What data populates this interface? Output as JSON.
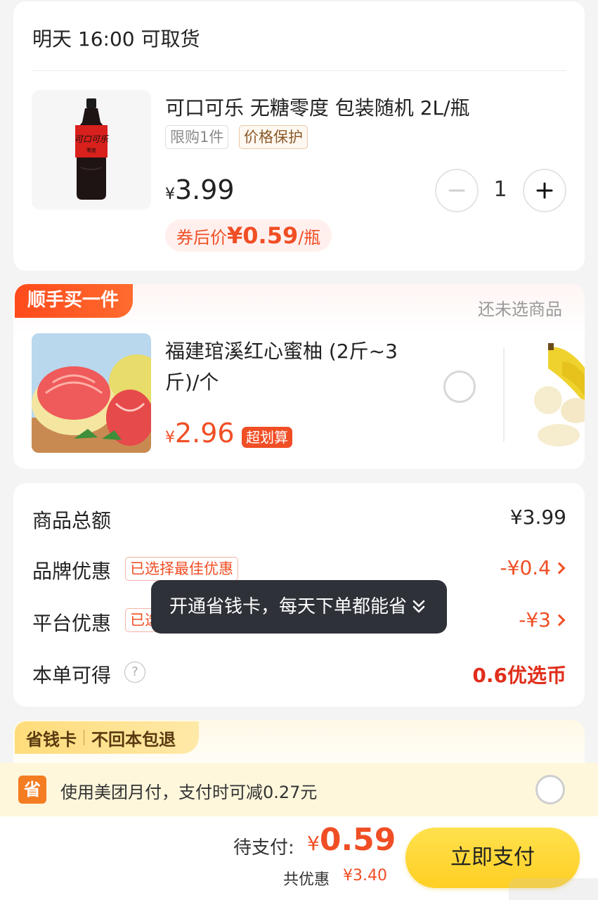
{
  "order": {
    "pickup_text": "明天 16:00 可取货",
    "product": {
      "title": "可口可乐 无糖零度 包装随机 2L/瓶",
      "tag_limit": "限购1件",
      "tag_protect": "价格保护",
      "price_symbol": "¥",
      "price": "3.99",
      "quantity": "1",
      "coupon_prefix": "券后价",
      "coupon_symbol": "¥",
      "coupon_price": "0.59",
      "coupon_unit": "/瓶"
    }
  },
  "addon": {
    "badge": "顺手买一件",
    "status": "还未选商品",
    "item": {
      "title": "福建琯溪红心蜜柚 (2斤~3斤)/个",
      "price_symbol": "¥",
      "price": "2.96",
      "deal": "超划算"
    }
  },
  "summary": {
    "total_label": "商品总额",
    "total_value": "¥3.99",
    "brand_label": "品牌优惠",
    "brand_tag": "已选择最佳优惠",
    "brand_value": "-¥0.4",
    "platform_label": "平台优惠",
    "platform_tag": "已选择最佳优惠",
    "platform_value": "-¥3",
    "coins_label": "本单可得",
    "coins_help": "?",
    "coins_value": "0.6优选币"
  },
  "tooltip": {
    "text": "开通省钱卡，每天下单都能省"
  },
  "savings_card": {
    "name": "省钱卡",
    "slogan": "不回本包退"
  },
  "payment_option": {
    "icon_text": "省",
    "text": "使用美团月付，支付时可减0.27元"
  },
  "bottom_bar": {
    "due_label": "待支付:",
    "due_symbol": "¥",
    "due_amount": "0.59",
    "saved_label": "共优惠",
    "saved_amount": "¥3.40",
    "pay_button": "立即支付"
  },
  "colors": {
    "accent_red": "#f04e25",
    "pay_button_yellow": "#ffd83a",
    "tooltip_dark": "#2e3138"
  }
}
